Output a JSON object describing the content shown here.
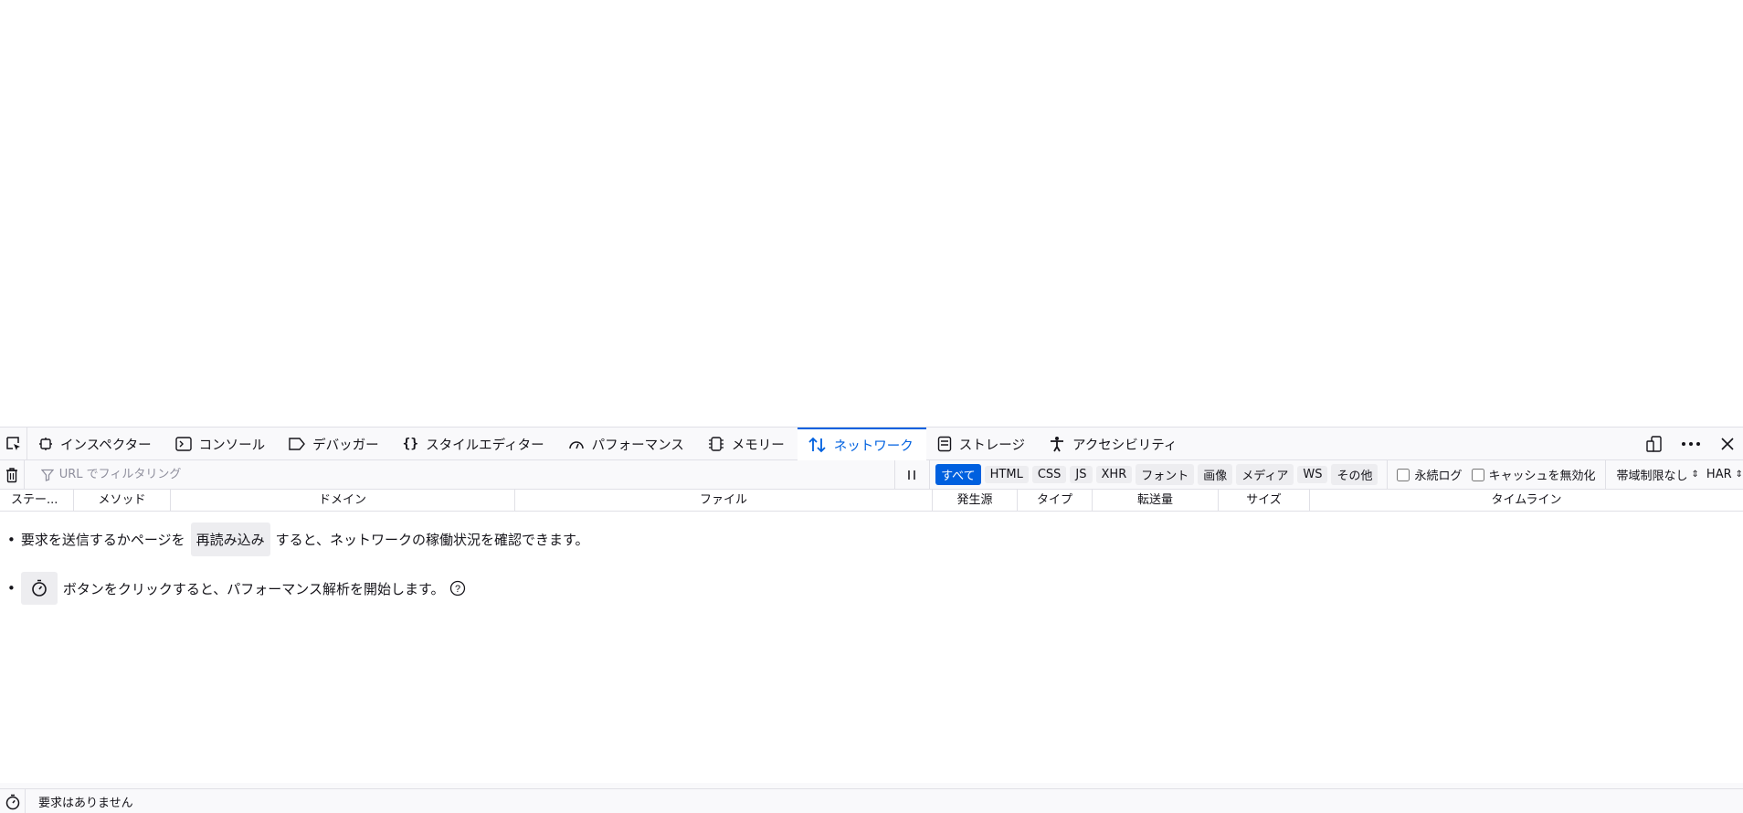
{
  "tabs": [
    {
      "id": "inspector",
      "label": "インスペクター",
      "icon": "inspector-icon"
    },
    {
      "id": "console",
      "label": "コンソール",
      "icon": "console-icon"
    },
    {
      "id": "debugger",
      "label": "デバッガー",
      "icon": "debugger-icon"
    },
    {
      "id": "style-editor",
      "label": "スタイルエディター",
      "icon": "style-editor-icon"
    },
    {
      "id": "performance",
      "label": "パフォーマンス",
      "icon": "performance-icon"
    },
    {
      "id": "memory",
      "label": "メモリー",
      "icon": "memory-icon"
    },
    {
      "id": "network",
      "label": "ネットワーク",
      "icon": "network-icon",
      "selected": true
    },
    {
      "id": "storage",
      "label": "ストレージ",
      "icon": "storage-icon"
    },
    {
      "id": "accessibility",
      "label": "アクセシビリティ",
      "icon": "accessibility-icon"
    }
  ],
  "toolbar": {
    "filter_placeholder": "URL でフィルタリング",
    "type_filters": [
      "すべて",
      "HTML",
      "CSS",
      "JS",
      "XHR",
      "フォント",
      "画像",
      "メディア",
      "WS",
      "その他"
    ],
    "active_type_filter": "すべて",
    "persist_logs_label": "永続ログ",
    "disable_cache_label": "キャッシュを無効化",
    "throttling_label": "帯域制限なし",
    "har_label": "HAR"
  },
  "columns": [
    "ステー...",
    "メソッド",
    "ドメイン",
    "ファイル",
    "発生源",
    "タイプ",
    "転送量",
    "サイズ",
    "タイムライン"
  ],
  "notice": {
    "line1_before": "要求を送信するかページを",
    "reload_button": "再読み込み",
    "line1_after": "すると、ネットワークの稼働状況を確認できます。",
    "line2_text": "ボタンをクリックすると、パフォーマンス解析を開始します。"
  },
  "status": {
    "text": "要求はありません"
  },
  "colors": {
    "accent": "#0061e0",
    "active_filter_bg": "#0060df"
  }
}
